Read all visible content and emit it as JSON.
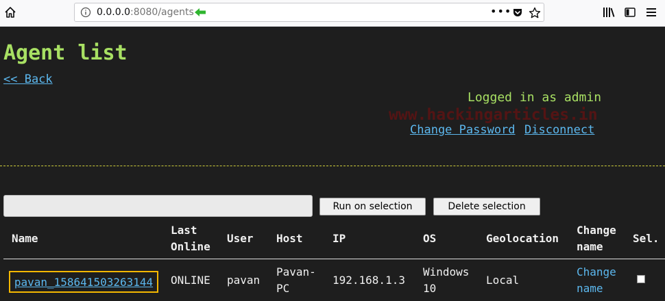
{
  "browser": {
    "url_host": "0.0.0.0",
    "url_port_path": ":8080/agents",
    "menu_dots": "•••",
    "icons": [
      "home-icon",
      "info-icon",
      "green-arrow-icon",
      "pocket-icon",
      "star-icon",
      "library-icon",
      "sidebar-icon",
      "hamburger-menu-icon"
    ]
  },
  "page": {
    "title": "Agent list",
    "back_label": "<< Back",
    "logged_in_text": "Logged in as admin",
    "change_password_label": "Change Password",
    "disconnect_label": "Disconnect",
    "watermark": "www.hackingarticles.in"
  },
  "toolbar": {
    "command_value": "",
    "run_label": "Run on selection",
    "delete_label": "Delete selection"
  },
  "table": {
    "headers": {
      "name": "Name",
      "last_online_1": "Last",
      "last_online_2": "Online",
      "user": "User",
      "host": "Host",
      "ip": "IP",
      "os": "OS",
      "geolocation": "Geolocation",
      "change_name_1": "Change",
      "change_name_2": "name",
      "sel": "Sel."
    },
    "rows": [
      {
        "name": "pavan_158641503263144",
        "last_online": "ONLINE",
        "user": "pavan",
        "host_1": "Pavan-",
        "host_2": "PC",
        "ip": "192.168.1.3",
        "os_1": "Windows",
        "os_2": "10",
        "geolocation": "Local",
        "change_name_1": "Change",
        "change_name_2": "name",
        "selected": false
      }
    ]
  },
  "colors": {
    "background": "#1e1e1e",
    "title_green": "#a8e063",
    "link_blue": "#5cb8ef",
    "highlight_box": "#f5b800",
    "divider_yellow": "#cfcf3a"
  }
}
